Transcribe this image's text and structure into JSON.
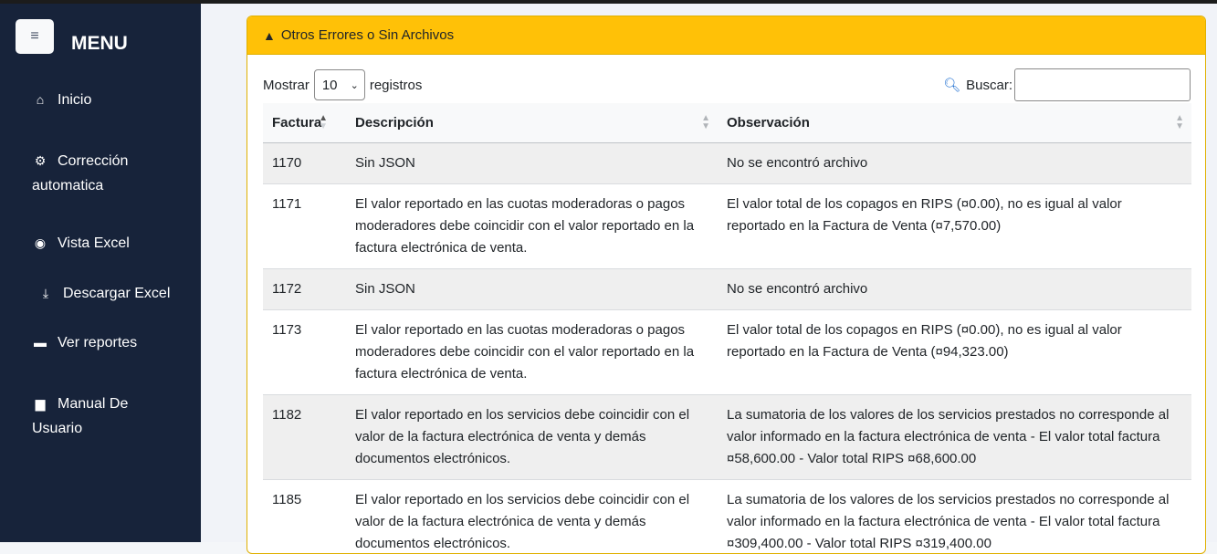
{
  "sidebar": {
    "title": "MENU",
    "items": [
      {
        "label": "Inicio",
        "icon": "home-icon"
      },
      {
        "label": "Corrección automatica",
        "icon": "gear-icon"
      },
      {
        "label": "Vista Excel",
        "icon": "eye-icon"
      },
      {
        "label": "Descargar Excel",
        "icon": "download-icon"
      },
      {
        "label": "Ver reportes",
        "icon": "folder-icon"
      },
      {
        "label": "Manual De Usuario",
        "icon": "book-icon"
      }
    ]
  },
  "card": {
    "title": "Otros Errores o Sin Archivos",
    "show_label": "Mostrar",
    "page_size": "10",
    "records_label": "registros",
    "search_label": "Buscar:"
  },
  "table": {
    "columns": [
      "Factura",
      "Descripción",
      "Observación"
    ],
    "rows": [
      {
        "factura": "1170",
        "descripcion": "Sin JSON",
        "observacion": "No se encontró archivo"
      },
      {
        "factura": "1171",
        "descripcion": "El valor reportado en las cuotas moderadoras o pagos moderadores debe coincidir con el valor reportado en la factura electrónica de venta.",
        "observacion": "El valor total de los copagos en RIPS (¤0.00), no es igual al valor reportado en la Factura de Venta (¤7,570.00)"
      },
      {
        "factura": "1172",
        "descripcion": "Sin JSON",
        "observacion": "No se encontró archivo"
      },
      {
        "factura": "1173",
        "descripcion": "El valor reportado en las cuotas moderadoras o pagos moderadores debe coincidir con el valor reportado en la factura electrónica de venta.",
        "observacion": "El valor total de los copagos en RIPS (¤0.00), no es igual al valor reportado en la Factura de Venta (¤94,323.00)"
      },
      {
        "factura": "1182",
        "descripcion": "El valor reportado en los servicios debe coincidir con el valor de la factura electrónica de venta y demás documentos electrónicos.",
        "observacion": "La sumatoria de los valores de los servicios prestados no corresponde al valor informado en la factura electrónica de venta - El valor total factura ¤58,600.00 - Valor total RIPS ¤68,600.00"
      },
      {
        "factura": "1185",
        "descripcion": "El valor reportado en los servicios debe coincidir con el valor de la factura electrónica de venta y demás documentos electrónicos.",
        "observacion": "La sumatoria de los valores de los servicios prestados no corresponde al valor informado en la factura electrónica de venta - El valor total factura ¤309,400.00 - Valor total RIPS ¤319,400.00"
      }
    ]
  }
}
